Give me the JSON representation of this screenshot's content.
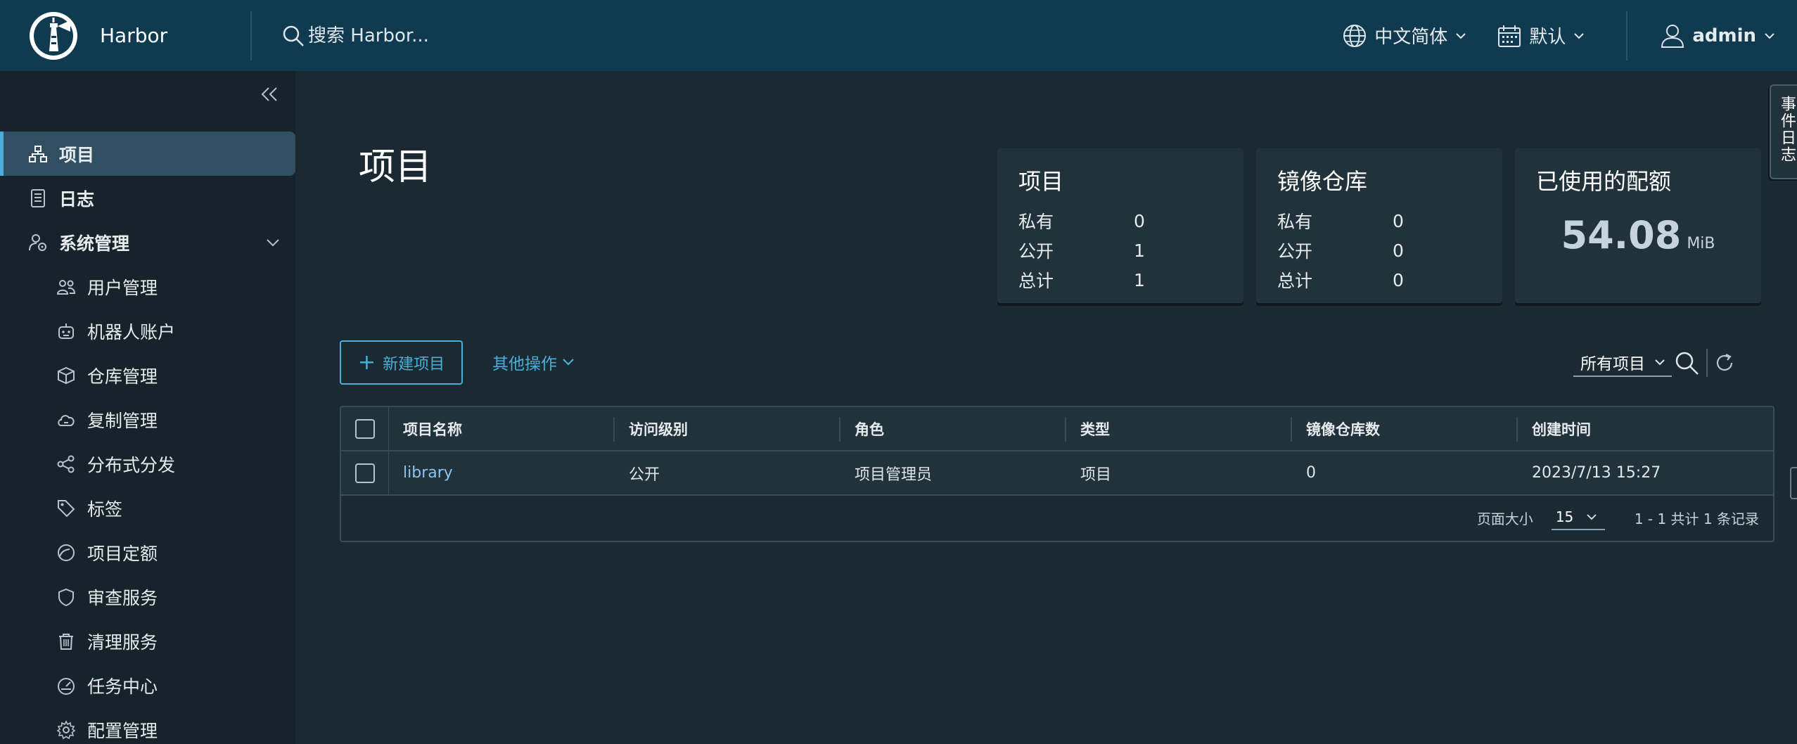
{
  "header": {
    "brand": "Harbor",
    "search_placeholder": "搜索 Harbor...",
    "language": "中文简体",
    "theme": "默认",
    "user": "admin"
  },
  "sidebar": {
    "items": [
      {
        "label": "项目",
        "icon": "projects-icon"
      },
      {
        "label": "日志",
        "icon": "log-icon"
      },
      {
        "label": "系统管理",
        "icon": "admin-icon"
      },
      {
        "label": "用户管理",
        "icon": "users-icon"
      },
      {
        "label": "机器人账户",
        "icon": "robot-icon"
      },
      {
        "label": "仓库管理",
        "icon": "box-icon"
      },
      {
        "label": "复制管理",
        "icon": "cloud-sync-icon"
      },
      {
        "label": "分布式分发",
        "icon": "share-icon"
      },
      {
        "label": "标签",
        "icon": "tag-icon"
      },
      {
        "label": "项目定额",
        "icon": "quota-icon"
      },
      {
        "label": "审查服务",
        "icon": "shield-icon"
      },
      {
        "label": "清理服务",
        "icon": "trash-icon"
      },
      {
        "label": "任务中心",
        "icon": "dashboard-icon"
      },
      {
        "label": "配置管理",
        "icon": "gear-icon"
      }
    ]
  },
  "main": {
    "title": "项目",
    "cards": {
      "projects": {
        "title": "项目",
        "private_label": "私有",
        "private": "0",
        "public_label": "公开",
        "public": "1",
        "total_label": "总计",
        "total": "1"
      },
      "repos": {
        "title": "镜像仓库",
        "private_label": "私有",
        "private": "0",
        "public_label": "公开",
        "public": "0",
        "total_label": "总计",
        "total": "0"
      },
      "quota": {
        "title": "已使用的配额",
        "value": "54.08",
        "unit": "MiB"
      }
    },
    "new_project": "新建项目",
    "other_actions": "其他操作",
    "filter": "所有项目",
    "table": {
      "columns": [
        "项目名称",
        "访问级别",
        "角色",
        "类型",
        "镜像仓库数",
        "创建时间"
      ],
      "rows": [
        {
          "name": "library",
          "access": "公开",
          "role": "项目管理员",
          "type": "项目",
          "repo_count": "0",
          "created": "2023/7/13 15:27"
        }
      ],
      "page_size_label": "页面大小",
      "page_size": "15",
      "summary": "1 - 1 共计 1 条记录"
    },
    "event_log": "事件日志"
  },
  "colors": {
    "header_bg": "#0f3a4f",
    "sidebar_bg": "#17232a",
    "main_bg": "#1b2a32",
    "accent": "#49afd9",
    "link": "#8cc4f0"
  }
}
